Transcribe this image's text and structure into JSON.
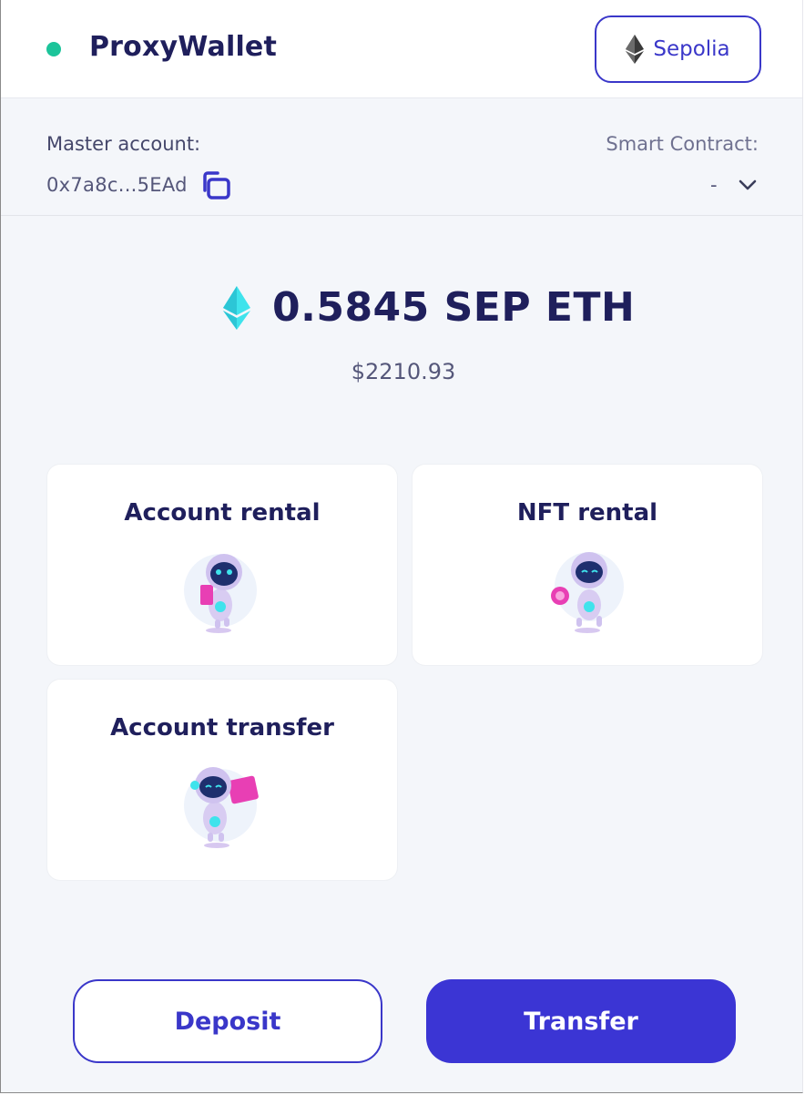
{
  "header": {
    "title": "ProxyWallet",
    "status_color": "#1cc49a",
    "network": {
      "label": "Sepolia",
      "icon": "ethereum-icon"
    }
  },
  "accounts": {
    "master_label": "Master account:",
    "master_address": "0x7a8c...5EAd",
    "copy_icon": "copy-icon",
    "smart_contract_label": "Smart Contract:",
    "smart_contract_value": "-",
    "dropdown_icon": "chevron-down-icon"
  },
  "balance": {
    "amount": "0.5845 SEP ETH",
    "fiat": "$2210.93",
    "icon": "ethereum-icon"
  },
  "actions": [
    {
      "title": "Account rental",
      "illustration": "robot-account-rental"
    },
    {
      "title": "NFT rental",
      "illustration": "robot-nft-rental"
    },
    {
      "title": "Account transfer",
      "illustration": "robot-account-transfer"
    }
  ],
  "buttons": {
    "deposit": "Deposit",
    "transfer": "Transfer"
  },
  "colors": {
    "accent": "#3a37c9",
    "primary_text": "#1f1f5c",
    "background": "#f4f6fa",
    "eth_cyan": "#2fd6e6"
  }
}
